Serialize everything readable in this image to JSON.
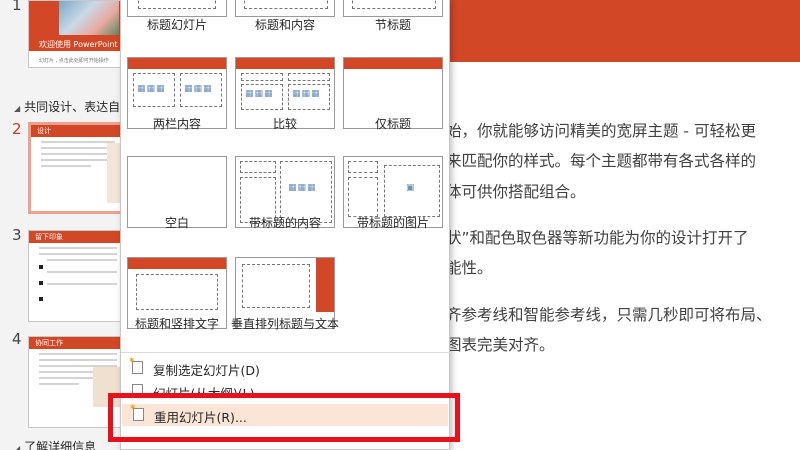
{
  "thumbnails": {
    "slide1": {
      "number": "1",
      "title": "欢迎使用 PowerPoint",
      "caption": "幻灯片 , 点击此处即可开始操作"
    },
    "section1": {
      "label": "共同设计、表达自"
    },
    "slide2": {
      "number": "2",
      "title": "设计"
    },
    "slide3": {
      "number": "3",
      "title": "留下印象"
    },
    "slide4": {
      "number": "4",
      "title": "协同工作"
    },
    "section2": {
      "label": "了解详细信息"
    }
  },
  "main": {
    "body_lines": [
      "始，你就能够访问精美的宽屏主题 - 可轻松更",
      "来匹配你的样式。每个主题都带有各式各样的",
      "体可供你搭配组合。",
      "状”和配色取色器等新功能为你的设计打开了",
      "能性。",
      "齐参考线和智能参考线，只需几秒即可将布局、",
      "图表完美对齐。"
    ]
  },
  "layout_menu": {
    "layouts": [
      {
        "label": "标题幻灯片"
      },
      {
        "label": "标题和内容"
      },
      {
        "label": "节标题"
      },
      {
        "label": "两栏内容"
      },
      {
        "label": "比较"
      },
      {
        "label": "仅标题"
      },
      {
        "label": "空白"
      },
      {
        "label": "带标题的内容"
      },
      {
        "label": "带标题的图片"
      },
      {
        "label": "标题和竖排文字"
      },
      {
        "label": "垂直排列标题与文本"
      }
    ],
    "commands": {
      "duplicate": "复制选定幻灯片(D)",
      "outline": "幻灯片(从大纲)(L)...",
      "reuse": "重用幻灯片(R)..."
    }
  },
  "colors": {
    "accent": "#d24726",
    "highlight": "#e8101a"
  }
}
